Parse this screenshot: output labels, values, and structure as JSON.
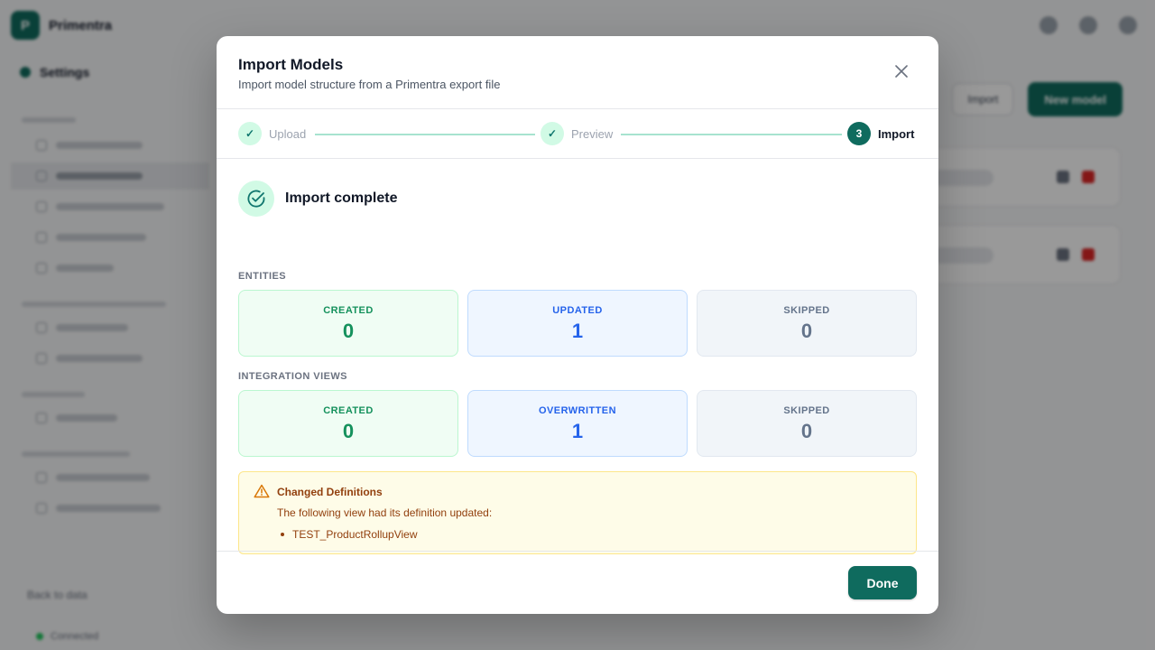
{
  "app": {
    "brand": "Primentra",
    "logo_letter": "P",
    "sidebar_header": "Settings",
    "sidebar_sections": [
      "",
      ""
    ],
    "new_model_label": "New model",
    "import_label": "Import",
    "back_label": "Back to data",
    "status_left": "Connected"
  },
  "modal": {
    "title": "Import Models",
    "subtitle": "Import model structure from a Primentra export file",
    "steps": [
      {
        "label": "Upload",
        "state": "done",
        "marker": "✓"
      },
      {
        "label": "Preview",
        "state": "done",
        "marker": "✓"
      },
      {
        "label": "Import",
        "state": "current",
        "marker": "3"
      }
    ],
    "complete_title": "Import complete",
    "entities": {
      "section_label": "ENTITIES",
      "stats": [
        {
          "label": "CREATED",
          "value": "0"
        },
        {
          "label": "UPDATED",
          "value": "1"
        },
        {
          "label": "SKIPPED",
          "value": "0"
        }
      ]
    },
    "integration_views": {
      "section_label": "INTEGRATION VIEWS",
      "stats": [
        {
          "label": "CREATED",
          "value": "0"
        },
        {
          "label": "OVERWRITTEN",
          "value": "1"
        },
        {
          "label": "SKIPPED",
          "value": "0"
        }
      ]
    },
    "warning": {
      "title": "Changed Definitions",
      "text": "The following view had its definition updated:",
      "items": [
        "TEST_ProductRollupView"
      ]
    },
    "done_label": "Done"
  },
  "colors": {
    "accent": "#0f6b5e",
    "created": "#15915c",
    "updated": "#2563eb",
    "skipped": "#64748b",
    "warning": "#92400e"
  }
}
